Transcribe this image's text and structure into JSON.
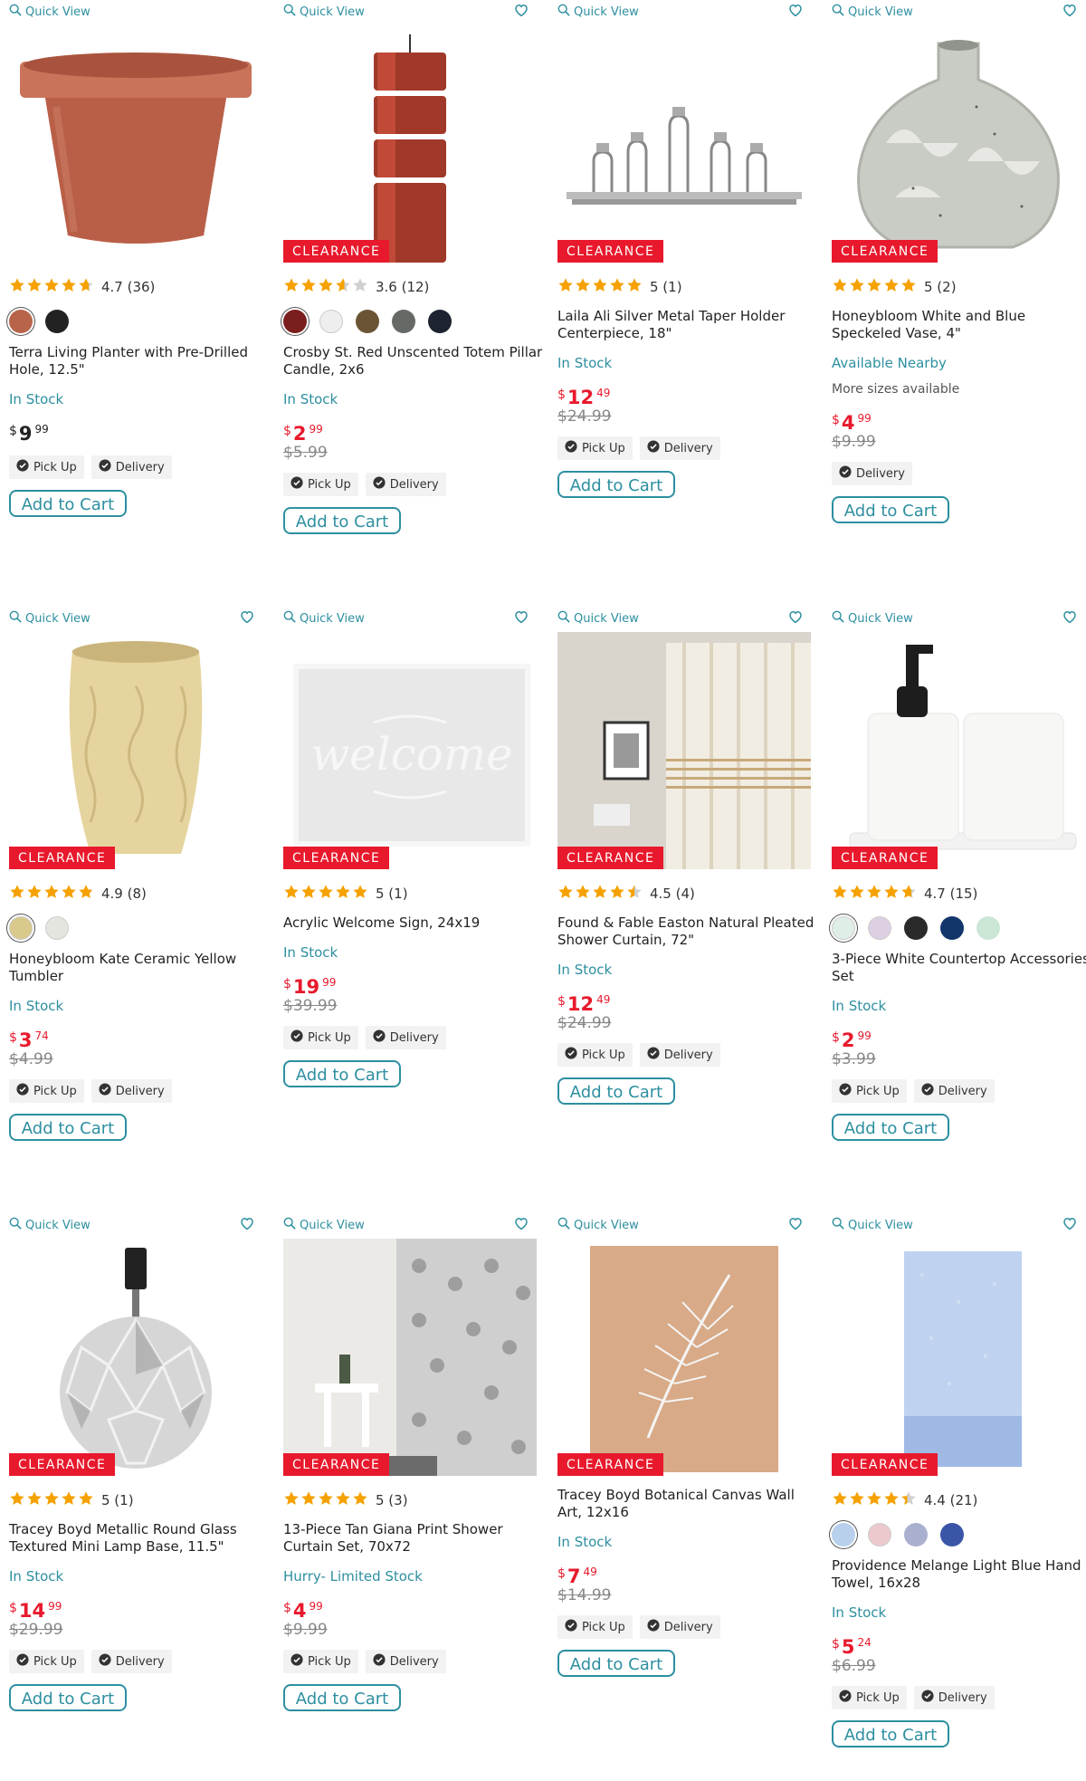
{
  "colors": {
    "accent": "#2d8fa0",
    "clearance": "#e8192c",
    "star": "#f5a100"
  },
  "common": {
    "quick_view": "Quick View",
    "clearance": "CLEARANCE",
    "add_to_cart": "Add to Cart",
    "pick_up": "Pick Up",
    "delivery": "Delivery",
    "currency": "$"
  },
  "products": [
    {
      "name": "Terra Living Planter with Pre-Drilled Hole, 12.5\"",
      "rating": 4.7,
      "reviews_text": "4.7 (36)",
      "clearance": false,
      "favorite": false,
      "swatches": [
        "#b8644a",
        "#222222"
      ],
      "stock": "In Stock",
      "more": "",
      "price_whole": "9",
      "price_cents": "99",
      "was": "",
      "pickup": true,
      "delivery": true,
      "image": "terracotta-planter"
    },
    {
      "name": "Crosby St. Red Unscented Totem Pillar Candle, 2x6",
      "rating": 3.6,
      "reviews_text": "3.6 (12)",
      "clearance": true,
      "favorite": true,
      "swatches": [
        "#7b1e1e",
        "#eeeeee",
        "#6b5436",
        "#666a66",
        "#1d2330"
      ],
      "stock": "In Stock",
      "more": "",
      "price_whole": "2",
      "price_cents": "99",
      "was": "$5.99",
      "pickup": true,
      "delivery": true,
      "image": "red-pillar-candle"
    },
    {
      "name": "Laila Ali Silver Metal Taper Holder Centerpiece, 18\"",
      "rating": 5,
      "reviews_text": "5 (1)",
      "clearance": true,
      "favorite": true,
      "swatches": [],
      "stock": "In Stock",
      "more": "",
      "price_whole": "12",
      "price_cents": "49",
      "was": "$24.99",
      "pickup": true,
      "delivery": true,
      "image": "silver-taper-holder"
    },
    {
      "name": "Honeybloom White and Blue Speckeled Vase, 4\"",
      "rating": 5,
      "reviews_text": "5 (2)",
      "clearance": true,
      "favorite": true,
      "swatches": [],
      "stock": "Available Nearby",
      "more": "More sizes available",
      "price_whole": "4",
      "price_cents": "99",
      "was": "$9.99",
      "pickup": false,
      "delivery": true,
      "image": "speckled-vase"
    },
    {
      "name": "Honeybloom Kate Ceramic Yellow Tumbler",
      "rating": 4.9,
      "reviews_text": "4.9 (8)",
      "clearance": true,
      "favorite": true,
      "swatches": [
        "#d9c98a",
        "#e5e5e0"
      ],
      "stock": "In Stock",
      "more": "",
      "price_whole": "3",
      "price_cents": "74",
      "was": "$4.99",
      "pickup": true,
      "delivery": true,
      "image": "yellow-tumbler"
    },
    {
      "name": "Acrylic Welcome Sign, 24x19",
      "rating": 5,
      "reviews_text": "5 (1)",
      "clearance": true,
      "favorite": true,
      "swatches": [],
      "stock": "In Stock",
      "more": "",
      "price_whole": "19",
      "price_cents": "99",
      "was": "$39.99",
      "pickup": true,
      "delivery": true,
      "image": "welcome-sign"
    },
    {
      "name": "Found & Fable Easton Natural Pleated Shower Curtain, 72\"",
      "rating": 4.5,
      "reviews_text": "4.5 (4)",
      "clearance": true,
      "favorite": true,
      "swatches": [],
      "stock": "In Stock",
      "more": "",
      "price_whole": "12",
      "price_cents": "49",
      "was": "$24.99",
      "pickup": true,
      "delivery": true,
      "image": "pleated-shower-curtain"
    },
    {
      "name": "3-Piece White Countertop Accessories Set",
      "rating": 4.7,
      "reviews_text": "4.7 (15)",
      "clearance": true,
      "favorite": true,
      "swatches": [
        "#dfeee6",
        "#ddd0e2",
        "#2a2a2a",
        "#12366a",
        "#cbe6d4"
      ],
      "stock": "In Stock",
      "more": "",
      "price_whole": "2",
      "price_cents": "99",
      "was": "$3.99",
      "pickup": true,
      "delivery": true,
      "image": "countertop-set"
    },
    {
      "name": "Tracey Boyd Metallic Round Glass Textured Mini Lamp Base, 11.5\"",
      "rating": 5,
      "reviews_text": "5 (1)",
      "clearance": true,
      "favorite": true,
      "swatches": [],
      "stock": "In Stock",
      "more": "",
      "price_whole": "14",
      "price_cents": "99",
      "was": "$29.99",
      "pickup": true,
      "delivery": true,
      "image": "glass-lamp-base"
    },
    {
      "name": "13-Piece Tan Giana Print Shower Curtain Set, 70x72",
      "rating": 5,
      "reviews_text": "5 (3)",
      "clearance": true,
      "favorite": true,
      "swatches": [],
      "stock": "Hurry- Limited Stock",
      "more": "",
      "price_whole": "4",
      "price_cents": "99",
      "was": "$9.99",
      "pickup": true,
      "delivery": true,
      "image": "print-shower-curtain"
    },
    {
      "name": "Tracey Boyd Botanical Canvas Wall Art, 12x16",
      "rating": 0,
      "reviews_text": "",
      "clearance": true,
      "favorite": true,
      "swatches": [],
      "stock": "In Stock",
      "more": "",
      "price_whole": "7",
      "price_cents": "49",
      "was": "$14.99",
      "pickup": true,
      "delivery": true,
      "image": "feather-canvas"
    },
    {
      "name": "Providence Melange Light Blue Hand Towel, 16x28",
      "rating": 4.4,
      "reviews_text": "4.4 (21)",
      "clearance": true,
      "favorite": true,
      "swatches": [
        "#b8d0ec",
        "#ecc9cd",
        "#a9b0cf",
        "#3a55a8"
      ],
      "stock": "In Stock",
      "more": "",
      "price_whole": "5",
      "price_cents": "24",
      "was": "$6.99",
      "pickup": true,
      "delivery": true,
      "image": "blue-hand-towel"
    }
  ]
}
